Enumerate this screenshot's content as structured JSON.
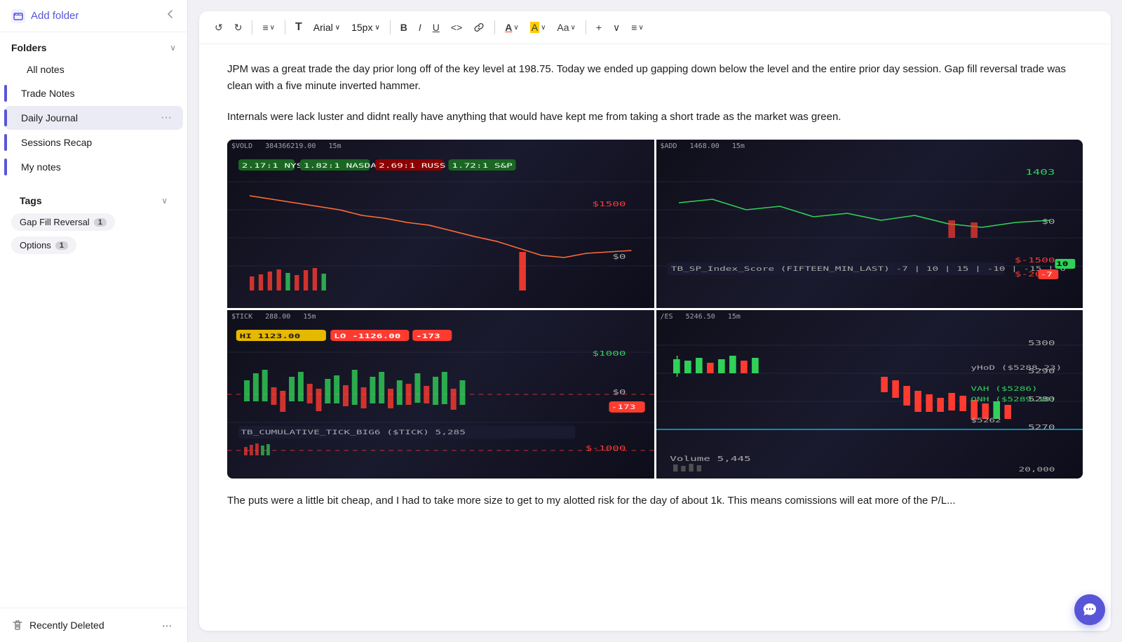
{
  "sidebar": {
    "add_folder_label": "Add folder",
    "collapse_icon": "‹",
    "folders_section": {
      "title": "Folders",
      "items": [
        {
          "id": "all-notes",
          "label": "All notes",
          "active": false,
          "has_indicator": false
        },
        {
          "id": "trade-notes",
          "label": "Trade Notes",
          "active": false,
          "has_indicator": true,
          "indicator_color": "#5856d6"
        },
        {
          "id": "daily-journal",
          "label": "Daily Journal",
          "active": true,
          "has_indicator": true,
          "indicator_color": "#5856d6"
        },
        {
          "id": "sessions-recap",
          "label": "Sessions Recap",
          "active": false,
          "has_indicator": true,
          "indicator_color": "#5856d6"
        },
        {
          "id": "my-notes",
          "label": "My notes",
          "active": false,
          "has_indicator": true,
          "indicator_color": "#5856d6"
        }
      ]
    },
    "tags_section": {
      "title": "Tags",
      "tags": [
        {
          "label": "Gap Fill Reversal",
          "count": 1
        },
        {
          "label": "Options",
          "count": 1
        }
      ]
    },
    "recently_deleted_label": "Recently Deleted"
  },
  "toolbar": {
    "undo_label": "↺",
    "redo_label": "↻",
    "align_label": "≡",
    "text_icon": "T",
    "font_label": "Arial",
    "font_size_label": "15px",
    "bold_label": "B",
    "italic_label": "I",
    "underline_label": "U",
    "code_label": "<>",
    "link_label": "⊞",
    "font_color_label": "A",
    "highlight_label": "A",
    "case_label": "Aa",
    "plus_label": "+",
    "more_label": "...",
    "list_label": "≡",
    "dropdown_label": "∨"
  },
  "editor": {
    "paragraph1": "JPM was a great trade the day prior long off of the key level at 198.75. Today we ended up gapping down below the level and the entire prior day session. Gap fill reversal trade was clean with a five minute inverted hammer.",
    "paragraph2": "Internals were  lack luster and didnt really have anything that would have kept me from taking a short trade as the market was green.",
    "paragraph3": "The puts were a little bit cheap, and I had to take more size to get to my alotted risk for the day of about 1k. This means comissions will eat more of the P/L..."
  },
  "charts": [
    {
      "label": "$VOLD",
      "value": "384366219.00",
      "timeframe": "15m"
    },
    {
      "label": "$ADD",
      "value": "1468.00",
      "timeframe": "15m"
    },
    {
      "label": "$TICK",
      "value": "288.00",
      "timeframe": "15m"
    },
    {
      "label": "/ES",
      "value": "5246.50",
      "timeframe": "15m"
    }
  ]
}
